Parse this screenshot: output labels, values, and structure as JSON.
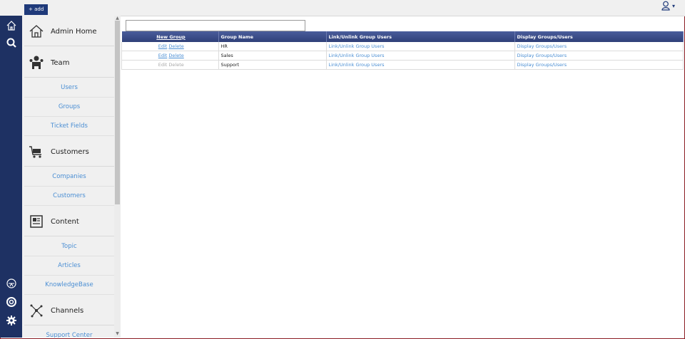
{
  "topbar": {
    "add_label": "+ add",
    "user_icon": "user-icon"
  },
  "rail": {
    "icons": [
      "home-icon",
      "search-icon",
      "support-icon",
      "help-icon",
      "settings-icon"
    ]
  },
  "nav": {
    "admin_home": "Admin Home",
    "team": {
      "label": "Team",
      "items": [
        "Users",
        "Groups",
        "Ticket Fields"
      ]
    },
    "customers": {
      "label": "Customers",
      "items": [
        "Companies",
        "Customers"
      ]
    },
    "content": {
      "label": "Content",
      "items": [
        "Topic",
        "Articles",
        "KnowledgeBase"
      ]
    },
    "channels": {
      "label": "Channels",
      "items": [
        "Support Center"
      ]
    }
  },
  "search": {
    "value": ""
  },
  "table": {
    "headers": [
      "New Group",
      "Group Name",
      "Link/Unlink Group Users",
      "Display Groups/Users"
    ],
    "rows": [
      {
        "edit": "Edit",
        "delete": "Delete",
        "name": "HR",
        "link": "Link/Unlink Group Users",
        "display": "Display Groups/Users"
      },
      {
        "edit": "Edit",
        "delete": "Delete",
        "name": "Sales",
        "link": "Link/Unlink Group Users",
        "display": "Display Groups/Users"
      },
      {
        "edit": "Edit",
        "delete": "Delete",
        "name": "Support",
        "link": "Link/Unlink Group Users",
        "display": "Display Groups/Users"
      }
    ]
  },
  "colors": {
    "rail": "#1e3163",
    "link": "#4a8ed3",
    "header": "#3a4c88",
    "frame": "#8b1d24"
  }
}
